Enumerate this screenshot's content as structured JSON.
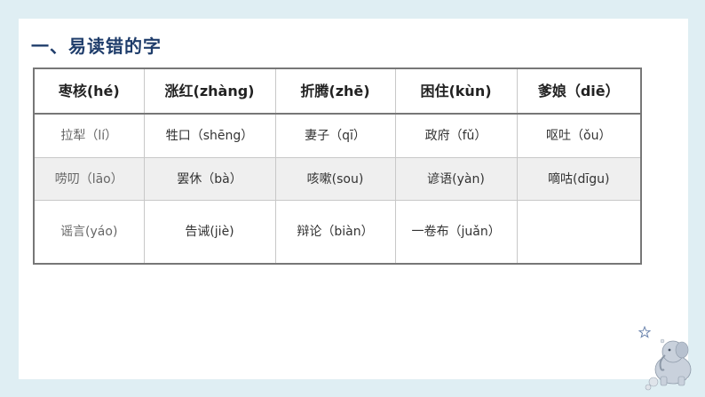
{
  "heading": "一、易读错的字",
  "table": {
    "header": [
      "枣核(hé)",
      "涨红(zhàng)",
      "折腾(zhē)",
      "困住(kùn)",
      "爹娘（diē）"
    ],
    "rows": [
      [
        "拉犁（lí）",
        "牲口（shēng）",
        "妻子（qī）",
        "政府（fǔ）",
        "呕吐（ǒu）"
      ],
      [
        "唠叨（lāo）",
        "罢休（bà）",
        "咳嗽(sou)",
        "谚语(yàn)",
        "嘀咕(dīgu)"
      ],
      [
        "谣言(yáo)",
        "告诫(jiè)",
        "辩论（biàn）",
        "一卷布（juǎn）",
        ""
      ]
    ]
  },
  "decor": {
    "star_icon": "star-icon",
    "elephant_icon": "elephant-icon",
    "colors": {
      "heading": "#1f3d6b",
      "frame": "#dfeef3",
      "shaded_row": "#efefef"
    }
  }
}
